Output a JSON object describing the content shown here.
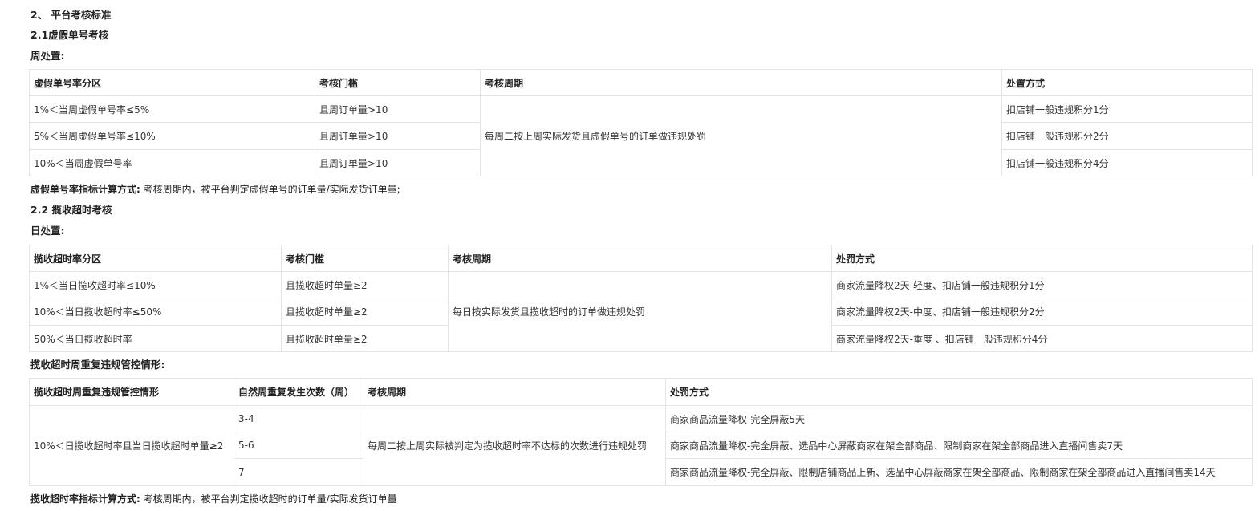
{
  "s2": {
    "title": "2、 平台考核标准",
    "s21_title": "2.1虚假单号考核",
    "week_label": "周处置:",
    "t1": {
      "headers": [
        "虚假单号率分区",
        "考核门槛",
        "考核周期",
        "处置方式"
      ],
      "rows": [
        [
          "1%＜当周虚假单号率≤5%",
          "且周订单量>10",
          "扣店铺一般违规积分1分"
        ],
        [
          "5%＜当周虚假单号率≤10%",
          "且周订单量>10",
          "扣店铺一般违规积分2分"
        ],
        [
          "10%＜当周虚假单号率",
          "且周订单量>10",
          "扣店铺一般违规积分4分"
        ]
      ],
      "cycle": "每周二按上周实际发货且虚假单号的订单做违规处罚"
    },
    "note1_label": "虚假单号率指标计算方式:",
    "note1_text": "考核周期内，被平台判定虚假单号的订单量/实际发货订单量;",
    "s22_title": "2.2 揽收超时考核",
    "day_label": "日处置:",
    "t2": {
      "headers": [
        "揽收超时率分区",
        "考核门槛",
        "考核周期",
        "处罚方式"
      ],
      "rows": [
        [
          "1%＜当日揽收超时率≤10%",
          "且揽收超时单量≥2",
          "商家流量降权2天-轻度、扣店铺一般违规积分1分"
        ],
        [
          "10%＜当日揽收超时率≤50%",
          "且揽收超时单量≥2",
          "商家流量降权2天-中度、扣店铺一般违规积分2分"
        ],
        [
          "50%＜当日揽收超时率",
          "且揽收超时单量≥2",
          "商家流量降权2天-重度 、扣店铺一般违规积分4分"
        ]
      ],
      "cycle": "每日按实际发货且揽收超时的订单做违规处罚"
    },
    "repeat_label": "揽收超时周重复违规管控情形:",
    "t3": {
      "headers": [
        "揽收超时周重复违规管控情形",
        "自然周重复发生次数（周）",
        "考核周期",
        "处罚方式"
      ],
      "situation": "10%＜日揽收超时率且当日揽收超时单量≥2",
      "cycle": "每周二按上周实际被判定为揽收超时率不达标的次数进行违规处罚",
      "rows": [
        [
          "3-4",
          "商家商品流量降权-完全屏蔽5天"
        ],
        [
          "5-6",
          "商家商品流量降权-完全屏蔽、选品中心屏蔽商家在架全部商品、限制商家在架全部商品进入直播间售卖7天"
        ],
        [
          "7",
          "商家商品流量降权-完全屏蔽、限制店铺商品上新、选品中心屏蔽商家在架全部商品、限制商家在架全部商品进入直播间售卖14天"
        ]
      ]
    },
    "note2_label": "揽收超时率指标计算方式:",
    "note2_text": "考核周期内，被平台判定揽收超时的订单量/实际发货订单量"
  }
}
